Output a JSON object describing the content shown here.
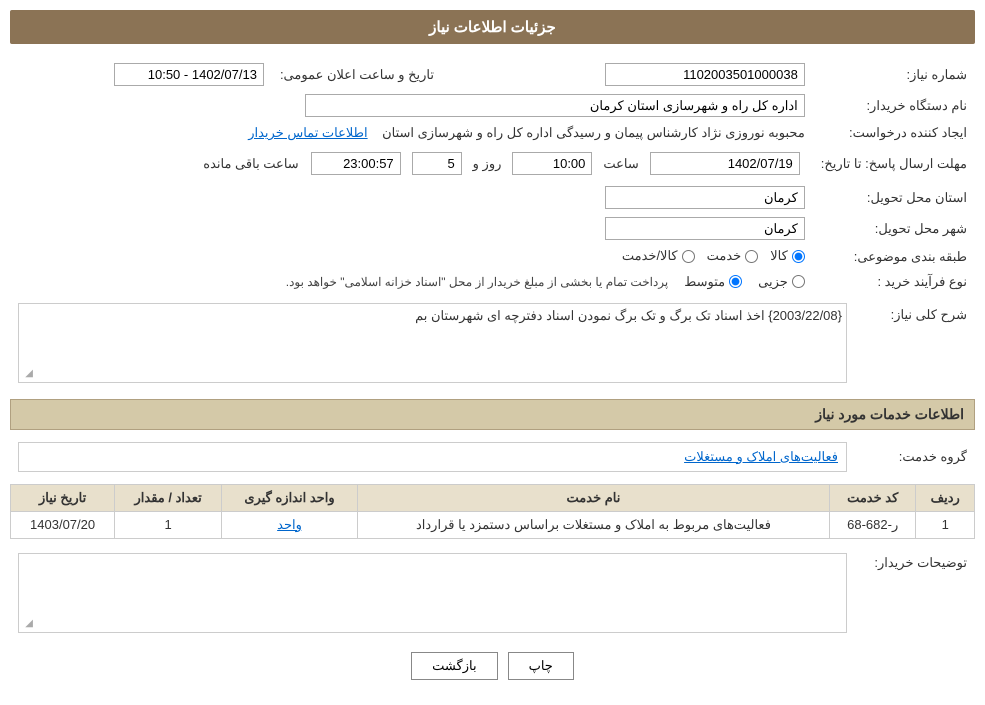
{
  "page": {
    "title": "جزئیات اطلاعات نیاز"
  },
  "section1": {
    "title": "جزئیات اطلاعات نیاز"
  },
  "section2": {
    "title": "اطلاعات خدمات مورد نیاز"
  },
  "fields": {
    "shomara_niaz_label": "شماره نیاز:",
    "shomara_niaz_value": "1102003501000038",
    "name_dastgah_label": "نام دستگاه خریدار:",
    "name_dastgah_value": "اداره کل راه و شهرسازی استان کرمان",
    "ijad_konande_label": "ایجاد کننده درخواست:",
    "ijad_konande_value": "محبوبه نوروزی نژاد کارشناس پیمان و رسیدگی اداره کل راه و شهرسازی استان",
    "ettelaat_tamas_label": "اطلاعات تماس خریدار",
    "mohlat_ersal_label": "مهلت ارسال پاسخ: تا تاریخ:",
    "tarikh_niaz_label": "1402/07/19",
    "saat_label": "ساعت",
    "saat_value": "10:00",
    "rooz_label": "روز و",
    "rooz_value": "5",
    "baqi_mande_label": "ساعت باقی مانده",
    "baqi_mande_value": "23:00:57",
    "ostan_tahvil_label": "استان محل تحویل:",
    "ostan_tahvil_value": "کرمان",
    "shahr_tahvil_label": "شهر محل تحویل:",
    "shahr_tahvil_value": "کرمان",
    "tabaghebandi_label": "طبقه بندی موضوعی:",
    "kala_label": "کالا",
    "khadamat_label": "خدمت",
    "kala_khadamat_label": "کالا/خدمت",
    "radio_kala_checked": true,
    "radio_khadamat_checked": false,
    "radio_kala_khadamat_checked": false,
    "tarikh_elan_label": "تاریخ و ساعت اعلان عمومی:",
    "tarikh_elan_value": "1402/07/13 - 10:50",
    "nooe_farayand_label": "نوع فرآیند خرید :",
    "jozii_label": "جزیی",
    "motavaset_label": "متوسط",
    "radio_jozii_checked": false,
    "radio_motavaset_checked": true,
    "payment_note": "پرداخت تمام یا بخشی از مبلغ خریدار از محل \"اسناد خزانه اسلامی\" خواهد بود."
  },
  "sharh": {
    "label": "شرح کلی نیاز:",
    "value": "{2003/22/08} اخذ اسناد تک برگ و تک برگ نمودن اسناد دفترچه ای شهرستان بم"
  },
  "grohe_khadamat": {
    "label": "گروه خدمت:",
    "value": "فعالیت‌های  املاک و مستغلات"
  },
  "services_table": {
    "headers": [
      "ردیف",
      "کد خدمت",
      "نام خدمت",
      "واحد اندازه گیری",
      "تعداد / مقدار",
      "تاریخ نیاز"
    ],
    "rows": [
      {
        "radif": "1",
        "kod_khadamat": "ر-682-68",
        "name_khadamat": "فعالیت‌های مربوط به املاک و مستغلات براساس دستمزد یا قرارداد",
        "vahed": "واحد",
        "tedad": "1",
        "tarikh": "1403/07/20"
      }
    ]
  },
  "tozihat": {
    "label": "توضیحات خریدار:"
  },
  "buttons": {
    "print_label": "چاپ",
    "back_label": "بازگشت"
  }
}
